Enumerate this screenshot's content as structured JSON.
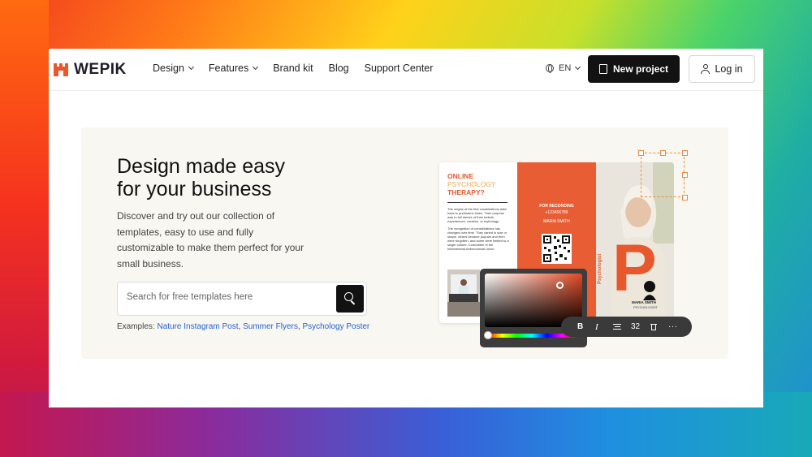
{
  "brand": {
    "name": "WEPIK",
    "accent": "#e8582d"
  },
  "nav": {
    "items": [
      {
        "label": "Design",
        "dropdown": true
      },
      {
        "label": "Features",
        "dropdown": true
      },
      {
        "label": "Brand kit",
        "dropdown": false
      },
      {
        "label": "Blog",
        "dropdown": false
      },
      {
        "label": "Support Center",
        "dropdown": false
      }
    ],
    "language": "EN",
    "new_project_label": "New project",
    "login_label": "Log in"
  },
  "hero": {
    "title_line1": "Design made easy",
    "title_line2": "for your business",
    "description": "Discover and try out our collection of templates, easy to use and fully customizable to make them perfect for your small business.",
    "search_placeholder": "Search for free templates here",
    "examples_label": "Examples:",
    "examples": [
      "Nature Instagram Post",
      "Summer Flyers",
      "Psychology Poster"
    ]
  },
  "preview": {
    "left_title": [
      "ONLINE",
      "PSYCHOLOGY",
      "THERAPY?"
    ],
    "left_text_1": "The origins of the first constellations date back to prehistoric times. Their purpose was to tell stories of their beliefs, experiences, creation, or mythology.",
    "left_text_2": "The recognition of constellations has changed over time. They varied in size or shape, others became popular and then were forgotten, and some were limited to a single culture. Committee of the International Astronomical Union",
    "mid_recording": "FOR RECORDING",
    "mid_phone": "+123456789",
    "mid_name": "MARIA SMITH",
    "right_letter": "P",
    "right_vertical": "Psychologist",
    "right_name": "MARIA SMITH",
    "right_role": "PSYCHOLOGIST",
    "toolbar": {
      "bold": "B",
      "italic": "I",
      "size": "32",
      "more": "···"
    }
  }
}
